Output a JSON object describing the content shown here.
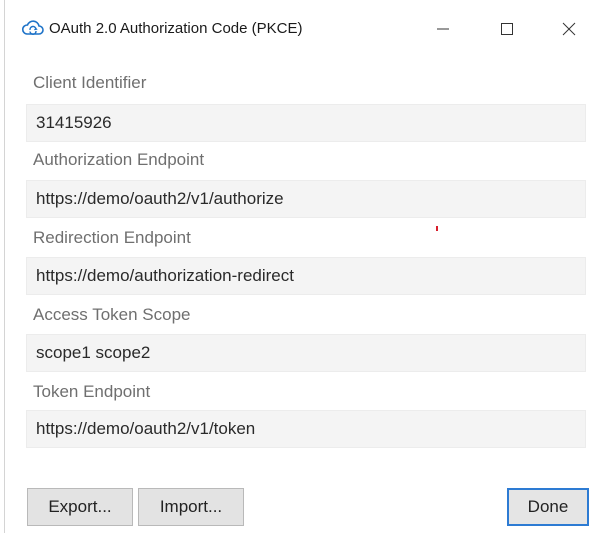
{
  "window": {
    "title": "OAuth 2.0 Authorization Code (PKCE)"
  },
  "fields": [
    {
      "label": "Client Identifier",
      "value": "31415926"
    },
    {
      "label": "Authorization Endpoint",
      "value": "https://demo/oauth2/v1/authorize"
    },
    {
      "label": "Redirection Endpoint",
      "value": "https://demo/authorization-redirect"
    },
    {
      "label": "Access Token Scope",
      "value": "scope1 scope2"
    },
    {
      "label": "Token Endpoint",
      "value": "https://demo/oauth2/v1/token"
    }
  ],
  "buttons": {
    "export": "Export...",
    "import": "Import...",
    "done": "Done"
  },
  "icons": {
    "app": "cloud-sync-icon",
    "minimize": "minimize-icon",
    "maximize": "maximize-icon",
    "close": "close-icon"
  },
  "colors": {
    "accent": "#2d7bd3",
    "app_icon": "#1e73c8",
    "field_bg": "#f4f4f4",
    "label": "#6f6f6f"
  }
}
